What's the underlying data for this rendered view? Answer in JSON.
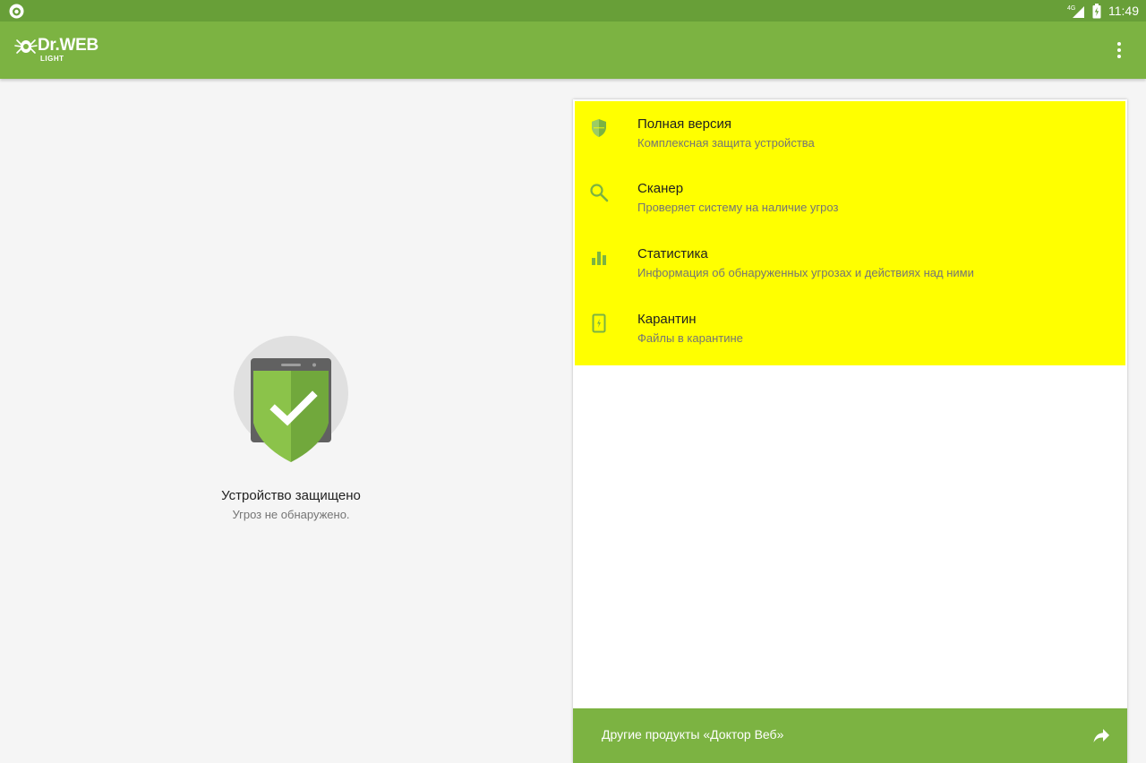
{
  "statusbar": {
    "time": "11:49",
    "network": "4G",
    "icons": [
      "drweb-notification-icon",
      "signal-icon",
      "battery-charging-icon"
    ]
  },
  "appbar": {
    "logo_text": "Dr.WEB",
    "logo_subtext": "LIGHT",
    "menu_icon": "more-vert-icon"
  },
  "status": {
    "title": "Устройство защищено",
    "subtitle": "Угроз не обнаружено.",
    "icon": "shield-check-icon"
  },
  "menu": {
    "items": [
      {
        "title": "Полная версия",
        "subtitle": "Комплексная защита устройства",
        "icon": "shield-icon"
      },
      {
        "title": "Сканер",
        "subtitle": "Проверяет систему на наличие угроз",
        "icon": "search-icon"
      },
      {
        "title": "Статистика",
        "subtitle": "Информация об обнаруженных угрозах и действиях над ними",
        "icon": "bar-chart-icon"
      },
      {
        "title": "Карантин",
        "subtitle": "Файлы в карантине",
        "icon": "quarantine-icon"
      }
    ],
    "highlight_color": "#ffff00"
  },
  "footer": {
    "label": "Другие продукты «Доктор Веб»",
    "icon": "share-icon"
  },
  "colors": {
    "primary": "#7cb342",
    "primary_dark": "#689f38",
    "icon_green": "#8bc34a"
  }
}
